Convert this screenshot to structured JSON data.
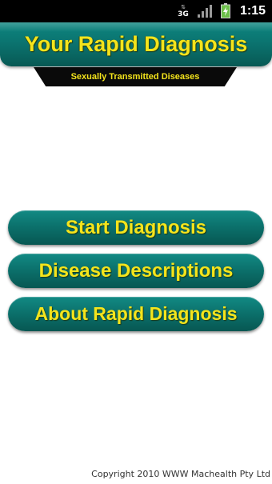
{
  "status_bar": {
    "network_type": "3G",
    "network_arrows": "⇅",
    "signal_icon": "signal-bars-icon",
    "battery_icon": "battery-charging-icon",
    "time": "1:15"
  },
  "header": {
    "title": "Your Rapid Diagnosis",
    "subtitle": "Sexually Transmitted Diseases"
  },
  "menu": {
    "buttons": [
      {
        "label": "Start Diagnosis"
      },
      {
        "label": "Disease Descriptions"
      },
      {
        "label": "About Rapid Diagnosis"
      }
    ]
  },
  "footer": {
    "copyright": "Copyright 2010 WWW Machealth Pty Ltd"
  },
  "colors": {
    "banner_teal": "#0b7470",
    "title_yellow": "#f4e41c",
    "ribbon_black": "#0a0a0a",
    "status_bar": "#000000",
    "background": "#ffffff"
  }
}
